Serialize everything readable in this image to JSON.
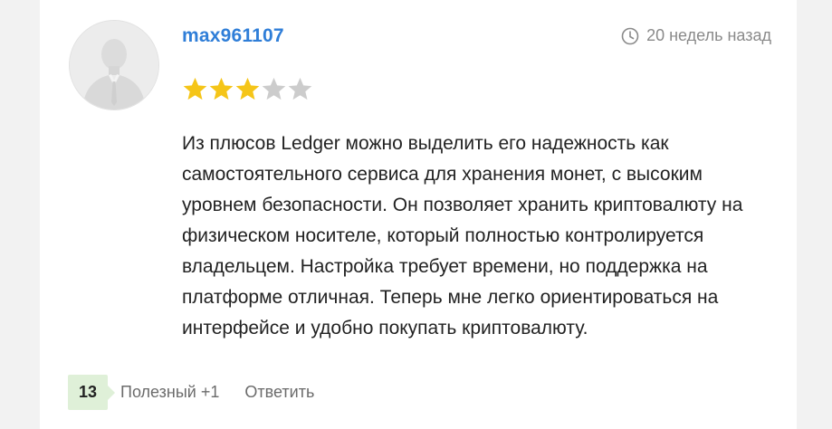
{
  "review": {
    "username": "max961107",
    "time": "20 недель назад",
    "rating": 3,
    "rating_max": 5,
    "star_color_filled": "#f5c518",
    "star_color_empty": "#cccccc",
    "text": "Из плюсов Ledger можно выделить его надежность как самостоятельного сервиса для хранения монет, с высоким уровнем безопасности. Он позволяет хранить криптовалюту на физическом носителе, который полностью контролируется владельцем. Настройка требует времени, но поддержка на платформе отличная. Теперь мне легко ориентироваться на интерфейсе и удобно покупать криптовалюту.",
    "votes": "13",
    "useful_label": "Полезный +1",
    "reply_label": "Ответить"
  },
  "colors": {
    "username": "#2f7ed8",
    "vote_bg": "#dff0d8"
  },
  "icons": {
    "avatar": "user-silhouette-icon",
    "time": "clock-icon",
    "rating": "star-icon"
  }
}
